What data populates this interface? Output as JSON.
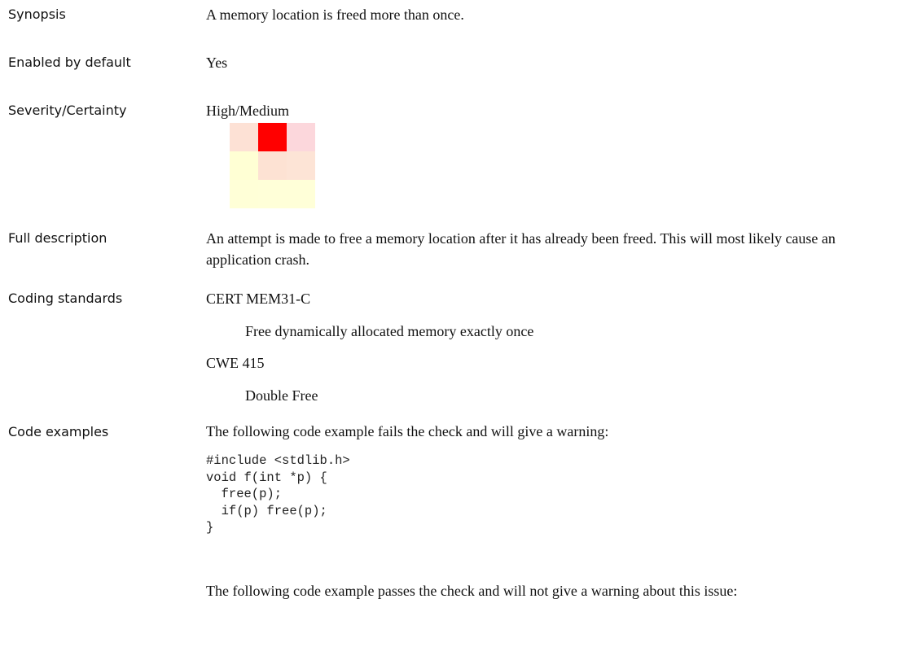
{
  "rows": {
    "synopsis": {
      "label": "Synopsis",
      "value": "A memory location is freed more than once."
    },
    "enabled_by_default": {
      "label": "Enabled by default",
      "value": "Yes"
    },
    "severity_certainty": {
      "label": "Severity/Certainty",
      "value": "High/Medium",
      "matrix_colors": [
        [
          "#fde1d5",
          "#ff0000",
          "#fcd7dc"
        ],
        [
          "#ffffd4",
          "#fde2d3",
          "#fde4d6"
        ],
        [
          "#ffffd7",
          "#ffffd8",
          "#ffffd8"
        ]
      ]
    },
    "full_description": {
      "label": "Full description",
      "value": "An attempt is made to free a memory location after it has already been freed. This will most likely cause an application crash."
    },
    "coding_standards": {
      "label": "Coding standards",
      "items": [
        {
          "name": "CERT MEM31-C",
          "description": "Free dynamically allocated memory exactly once"
        },
        {
          "name": "CWE 415",
          "description": "Double Free"
        }
      ]
    },
    "code_examples": {
      "label": "Code examples",
      "fail_intro": "The following code example fails the check and will give a warning:",
      "fail_code": "#include <stdlib.h>\nvoid f(int *p) {\n  free(p);\n  if(p) free(p);\n}",
      "pass_intro": "The following code example passes the check and will not give a warning about this issue:"
    }
  }
}
